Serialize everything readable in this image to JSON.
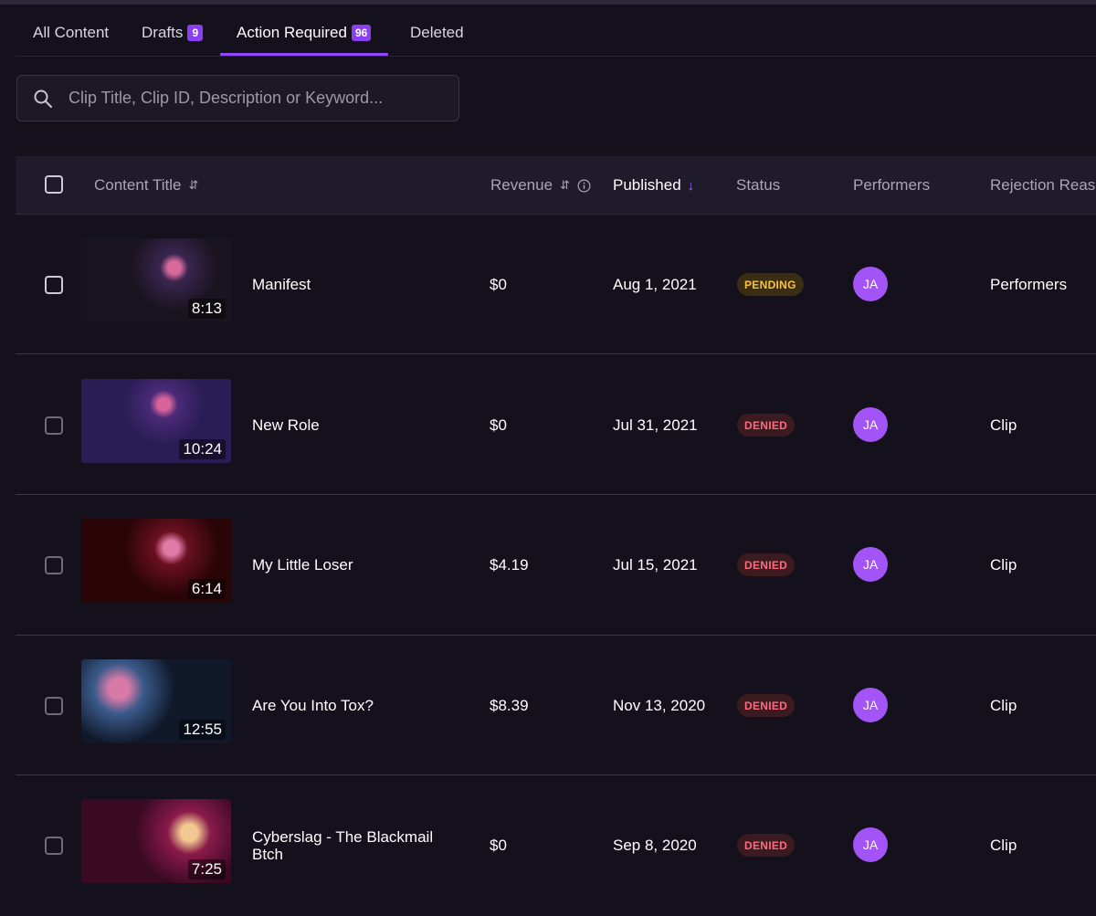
{
  "tabs": [
    {
      "label": "All Content",
      "badge": null
    },
    {
      "label": "Drafts",
      "badge": "9"
    },
    {
      "label": "Action Required",
      "badge": "96",
      "active": true
    },
    {
      "label": "Deleted",
      "badge": null
    }
  ],
  "search": {
    "placeholder": "Clip Title, Clip ID, Description or Keyword...",
    "value": "",
    "icon": "search-icon"
  },
  "table": {
    "columns": {
      "title": "Content Title",
      "revenue": "Revenue",
      "published": "Published",
      "status": "Status",
      "performers": "Performers",
      "rejection": "Rejection Reason"
    },
    "rows": [
      {
        "title": "Manifest",
        "duration": "8:13",
        "revenue": "$0",
        "published": "Aug 1, 2021",
        "status": "PENDING",
        "performer": "JA",
        "rejection": "Performers"
      },
      {
        "title": "New Role",
        "duration": "10:24",
        "revenue": "$0",
        "published": "Jul 31, 2021",
        "status": "DENIED",
        "performer": "JA",
        "rejection": "Clip"
      },
      {
        "title": "My Little Loser",
        "duration": "6:14",
        "revenue": "$4.19",
        "published": "Jul 15, 2021",
        "status": "DENIED",
        "performer": "JA",
        "rejection": "Clip"
      },
      {
        "title": "Are You Into Tox?",
        "duration": "12:55",
        "revenue": "$8.39",
        "published": "Nov 13, 2020",
        "status": "DENIED",
        "performer": "JA",
        "rejection": "Clip"
      },
      {
        "title": "Cyberslag - The Blackmail Btch",
        "duration": "7:25",
        "revenue": "$0",
        "published": "Sep 8, 2020",
        "status": "DENIED",
        "performer": "JA",
        "rejection": "Clip"
      }
    ]
  },
  "colors": {
    "accent": "#9146ff",
    "avatar": "#a354f7",
    "pending": "#f5c542",
    "denied": "#ff6b7d",
    "background": "#14111c"
  }
}
